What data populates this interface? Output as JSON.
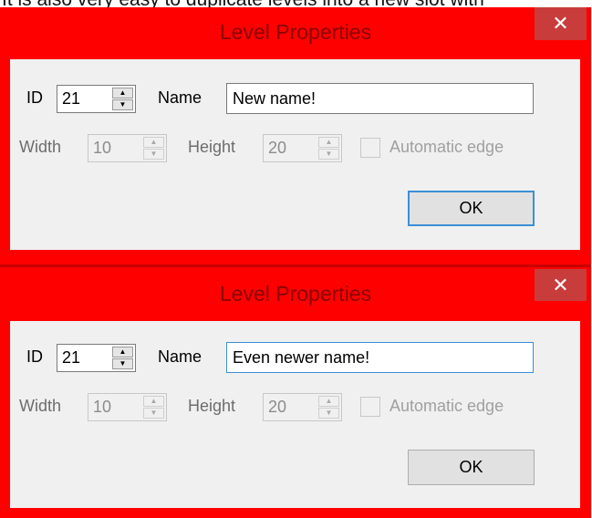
{
  "caption": "It is also very easy to duplicate levels into a new slot with",
  "dialogs": [
    {
      "title": "Level Properties",
      "close_symbol": "✕",
      "id_label": "ID",
      "id_value": "21",
      "name_label": "Name",
      "name_value": "New name!",
      "width_label": "Width",
      "width_value": "10",
      "height_label": "Height",
      "height_value": "20",
      "automatic_edge_label": "Automatic edge",
      "ok_label": "OK"
    },
    {
      "title": "Level Properties",
      "close_symbol": "✕",
      "id_label": "ID",
      "id_value": "21",
      "name_label": "Name",
      "name_value": "Even newer name!",
      "width_label": "Width",
      "width_value": "10",
      "height_label": "Height",
      "height_value": "20",
      "automatic_edge_label": "Automatic edge",
      "ok_label": "OK"
    }
  ],
  "colors": {
    "frame": "#ff0000",
    "title_text": "#8a0000",
    "close_button": "#c93c3c",
    "client": "#f0f0f0",
    "focus": "#3c8fd6"
  },
  "icons": {
    "spin_up": "▲",
    "spin_down": "▼"
  }
}
